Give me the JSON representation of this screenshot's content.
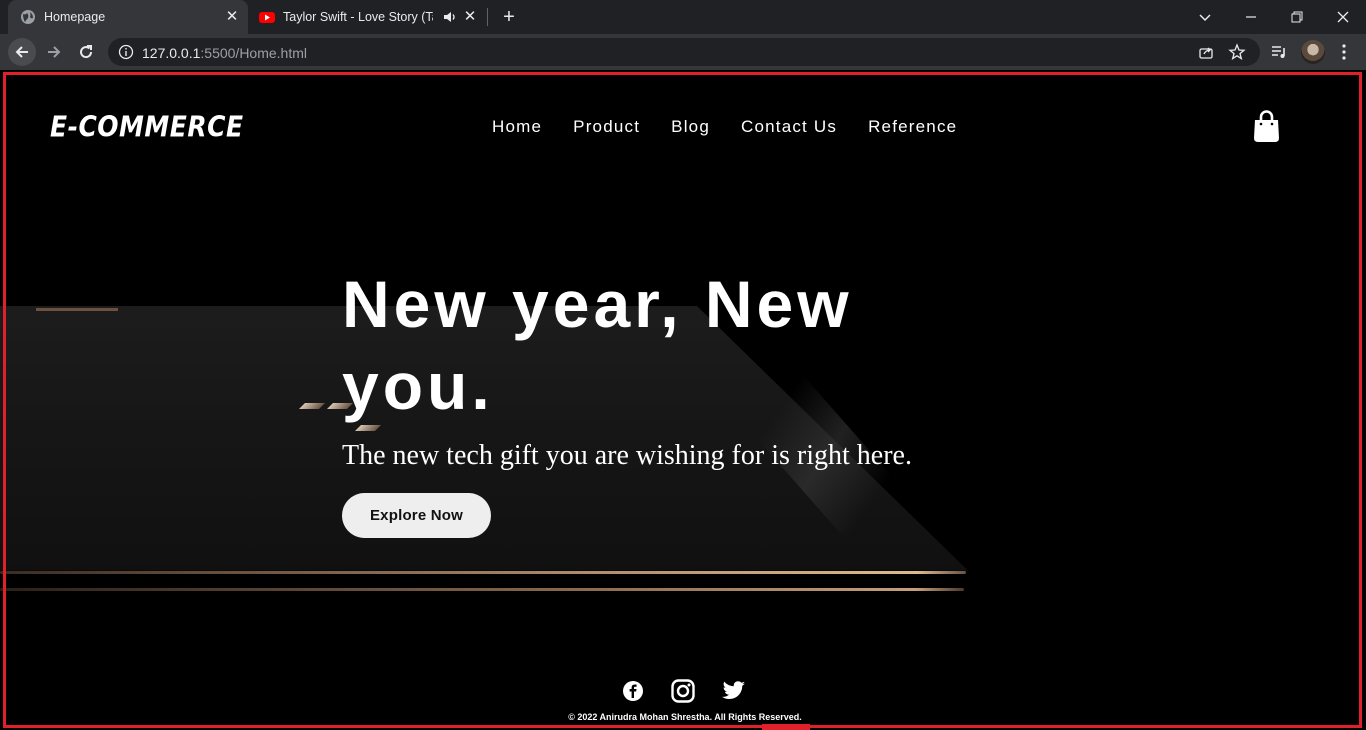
{
  "browser": {
    "tabs": [
      {
        "title": "Homepage",
        "active": true,
        "favicon": "globe-icon"
      },
      {
        "title": "Taylor Swift - Love Story (Taylor",
        "active": false,
        "favicon": "youtube-icon",
        "audio": true
      }
    ],
    "url": {
      "host": "127.0.0.1",
      "rest": ":5500/Home.html"
    },
    "accent_color": "#e0202a"
  },
  "site": {
    "logo": "E-COMMERCE",
    "nav": [
      "Home",
      "Product",
      "Blog",
      "Contact Us",
      "Reference"
    ],
    "cart_icon": "shopping-bag-icon"
  },
  "hero": {
    "title": "New year, New you.",
    "subtitle": "The new tech gift you are wishing for is right here.",
    "cta": "Explore Now"
  },
  "footer": {
    "social": [
      "facebook-icon",
      "instagram-icon",
      "twitter-icon"
    ],
    "copyright": "© 2022 Anirudra Mohan Shrestha. All Rights Reserved."
  }
}
